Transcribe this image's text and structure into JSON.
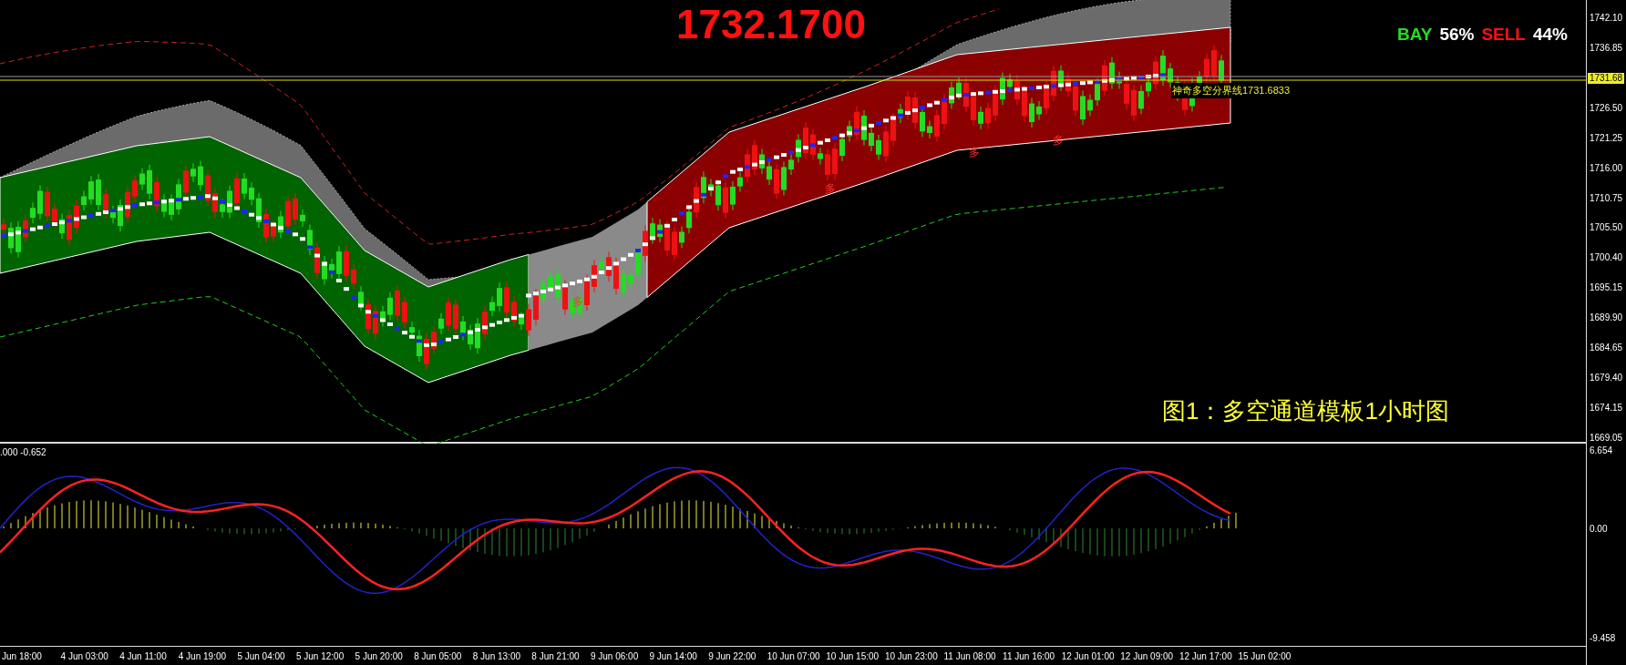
{
  "chart": {
    "current_price": "1732.1700",
    "sentiment": [
      {
        "kind": "buy",
        "label": "BAY",
        "value": "56%"
      },
      {
        "kind": "sell",
        "label": "SELL",
        "value": "44%"
      }
    ],
    "divider_line_label": "神奇多空分界线1731.6833",
    "price_tag": "1731.68",
    "caption": "图1：多空通道模板1小时图",
    "signals": [
      {
        "text": "多"
      },
      {
        "text": "多"
      },
      {
        "text": "多"
      },
      {
        "text": "多"
      }
    ]
  },
  "price_axis": [
    "1742.10",
    "1736.85",
    "1726.50",
    "1721.25",
    "1716.00",
    "1710.75",
    "1705.50",
    "1700.40",
    "1695.15",
    "1689.90",
    "1684.65",
    "1679.40",
    "1674.15",
    "1669.05"
  ],
  "indicator": {
    "values": ".000 -0.652",
    "axis": [
      "6.654",
      "0.00",
      "-9.458"
    ]
  },
  "time_axis": [
    "Jun 18:00",
    "4 Jun 03:00",
    "4 Jun 11:00",
    "4 Jun 19:00",
    "5 Jun 04:00",
    "5 Jun 12:00",
    "5 Jun 20:00",
    "8 Jun 05:00",
    "8 Jun 13:00",
    "8 Jun 21:00",
    "9 Jun 06:00",
    "9 Jun 14:00",
    "9 Jun 22:00",
    "10 Jun 07:00",
    "10 Jun 15:00",
    "10 Jun 23:00",
    "11 Jun 08:00",
    "11 Jun 16:00",
    "12 Jun 01:00",
    "12 Jun 09:00",
    "12 Jun 17:00",
    "15 Jun 02:00"
  ]
}
